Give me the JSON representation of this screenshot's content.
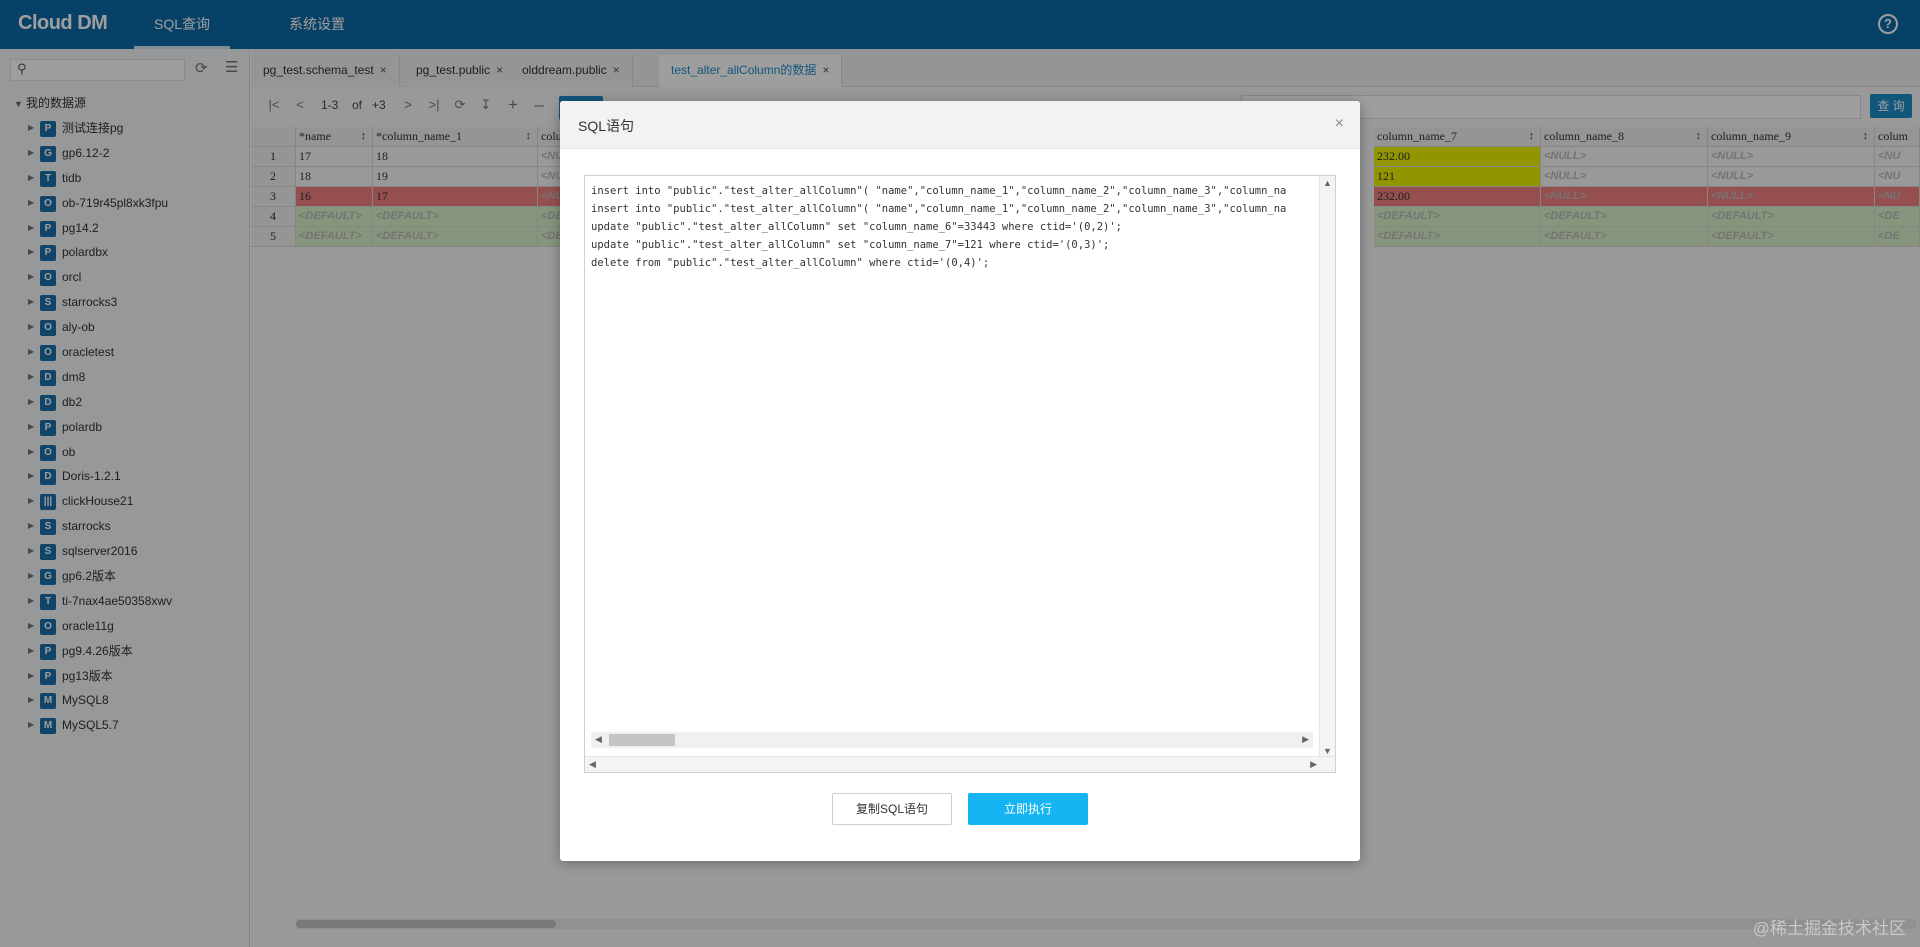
{
  "header": {
    "logo": "Cloud DM",
    "nav_sql": "SQL查询",
    "nav_settings": "系统设置",
    "help_glyph": "?"
  },
  "sidebar": {
    "search_placeholder": "",
    "root_label": "我的数据源",
    "items": [
      {
        "label": "测试连接pg",
        "icon": "pg-icon"
      },
      {
        "label": "gp6.12-2",
        "icon": "gp-icon"
      },
      {
        "label": "tidb",
        "icon": "tidb-icon"
      },
      {
        "label": "ob-719r45pl8xk3fpu",
        "icon": "ob-icon"
      },
      {
        "label": "pg14.2",
        "icon": "pg-icon"
      },
      {
        "label": "polardbx",
        "icon": "polardb-icon"
      },
      {
        "label": "orcl",
        "icon": "oracle-icon"
      },
      {
        "label": "starrocks3",
        "icon": "starrocks-icon"
      },
      {
        "label": "aly-ob",
        "icon": "ob-icon"
      },
      {
        "label": "oracletest",
        "icon": "oracle-icon"
      },
      {
        "label": "dm8",
        "icon": "dm-icon"
      },
      {
        "label": "db2",
        "icon": "db2-icon"
      },
      {
        "label": "polardb",
        "icon": "polardb-icon"
      },
      {
        "label": "ob",
        "icon": "ob-icon"
      },
      {
        "label": "Doris-1.2.1",
        "icon": "doris-icon"
      },
      {
        "label": "clickHouse21",
        "icon": "clickhouse-icon"
      },
      {
        "label": "starrocks",
        "icon": "starrocks-icon"
      },
      {
        "label": "sqlserver2016",
        "icon": "sqlserver-icon"
      },
      {
        "label": "gp6.2版本",
        "icon": "gp-icon"
      },
      {
        "label": "ti-7nax4ae50358xwv",
        "icon": "tidb-icon"
      },
      {
        "label": "oracle11g",
        "icon": "oracle-icon"
      },
      {
        "label": "pg9.4.26版本",
        "icon": "pg-icon"
      },
      {
        "label": "pg13版本",
        "icon": "pg-icon"
      },
      {
        "label": "MySQL8",
        "icon": "mysql-icon"
      },
      {
        "label": "MySQL5.7",
        "icon": "mysql-icon"
      }
    ]
  },
  "tabs": [
    {
      "label": "pg_test.schema_test",
      "close": "×"
    },
    {
      "label": "pg_test.public",
      "close": "×"
    },
    {
      "label": "olddream.public",
      "close": "×"
    },
    {
      "label": "test_alter_allColumn的数据",
      "close": "×"
    }
  ],
  "toolbar": {
    "range": "1-3",
    "of": "of",
    "total": "+3",
    "query_label": "查 询"
  },
  "grid": {
    "headers": [
      "*name",
      "*column_name_1",
      "colu",
      "column_name_7",
      "column_name_8",
      "column_name_9",
      "colum"
    ],
    "rows": [
      {
        "num": "1",
        "name": "17",
        "c1": "18",
        "c2": "<NU",
        "c7": "232.00",
        "c8": "<NULL>",
        "c9": "<NULL>",
        "c10": "<NU"
      },
      {
        "num": "2",
        "name": "18",
        "c1": "19",
        "c2": "<NU",
        "c7": "121",
        "c8": "<NULL>",
        "c9": "<NULL>",
        "c10": "<NU"
      },
      {
        "num": "3",
        "name": "16",
        "c1": "17",
        "c2": "<NU",
        "c7": "232.00",
        "c8": "<NULL>",
        "c9": "<NULL>",
        "c10": "<NU"
      },
      {
        "num": "4",
        "name": "<DEFAULT>",
        "c1": "<DEFAULT>",
        "c2": "<DE",
        "c7": "<DEFAULT>",
        "c8": "<DEFAULT>",
        "c9": "<DEFAULT>",
        "c10": "<DE"
      },
      {
        "num": "5",
        "name": "<DEFAULT>",
        "c1": "<DEFAULT>",
        "c2": "<DE",
        "c7": "<DEFAULT>",
        "c8": "<DEFAULT>",
        "c9": "<DEFAULT>",
        "c10": "<DE"
      }
    ]
  },
  "modal": {
    "title": "SQL语句",
    "close": "×",
    "sql_lines": [
      "insert into \"public\".\"test_alter_allColumn\"( \"name\",\"column_name_1\",\"column_name_2\",\"column_name_3\",\"column_na",
      "insert into \"public\".\"test_alter_allColumn\"( \"name\",\"column_name_1\",\"column_name_2\",\"column_name_3\",\"column_na",
      "update \"public\".\"test_alter_allColumn\" set \"column_name_6\"=33443 where ctid='(0,2)';",
      "update \"public\".\"test_alter_allColumn\" set \"column_name_7\"=121 where ctid='(0,3)';",
      "delete from \"public\".\"test_alter_allColumn\" where ctid='(0,4)';"
    ],
    "copy_button": "复制SQL语句",
    "execute_button": "立即执行"
  },
  "watermark": "@稀土掘金技术社区",
  "colors": {
    "topbar": "#0e6aa6",
    "accent": "#1e8cc8",
    "execute": "#15b4f2",
    "deleted_row": "#f08080",
    "new_row": "#d8f0c8",
    "modified_cell": "#e8f000"
  }
}
